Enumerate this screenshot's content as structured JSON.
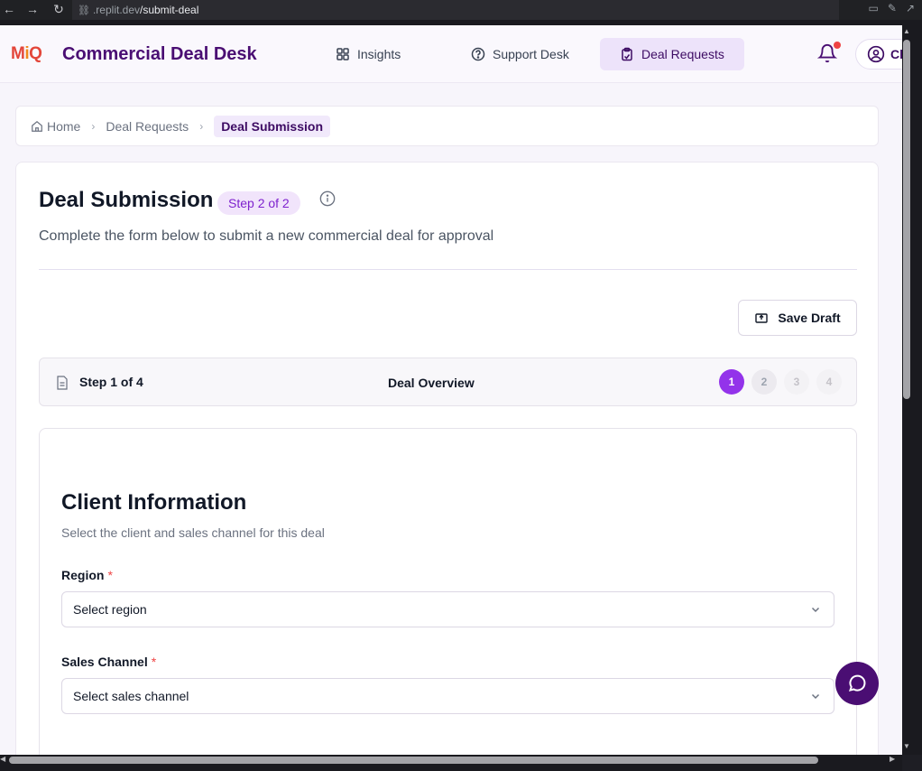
{
  "browser": {
    "url_domain": ".replit.dev",
    "url_path": "/submit-deal"
  },
  "header": {
    "logo_text": "MiQ",
    "app_title": "Commercial Deal Desk",
    "nav": [
      {
        "label": "Insights",
        "icon": "grid-icon"
      },
      {
        "label": "Support Desk",
        "icon": "help-circle-icon"
      },
      {
        "label": "Deal Requests",
        "icon": "clipboard-icon",
        "active": true
      }
    ],
    "user_initials": "Cl",
    "notification_dot": "#ef4444"
  },
  "breadcrumb": {
    "home": "Home",
    "parent": "Deal Requests",
    "current": "Deal Submission"
  },
  "page": {
    "title": "Deal Submission",
    "step_pill": "Step 2 of 2",
    "subtitle": "Complete the form below to submit a new commercial deal for approval",
    "save_draft": "Save Draft"
  },
  "stepper": {
    "step_label": "Step 1 of 4",
    "step_name": "Deal Overview",
    "steps": [
      "1",
      "2",
      "3",
      "4"
    ],
    "active_step": 1
  },
  "form": {
    "section_title": "Client Information",
    "section_subtitle": "Select the client and sales channel for this deal",
    "fields": [
      {
        "label": "Region",
        "required": true,
        "placeholder": "Select region"
      },
      {
        "label": "Sales Channel",
        "required": true,
        "placeholder": "Select sales channel"
      }
    ],
    "required_marker": "*"
  },
  "colors": {
    "brand_purple": "#4a0e73",
    "accent_purple": "#9333ea",
    "active_nav_bg": "#ede3fa"
  }
}
